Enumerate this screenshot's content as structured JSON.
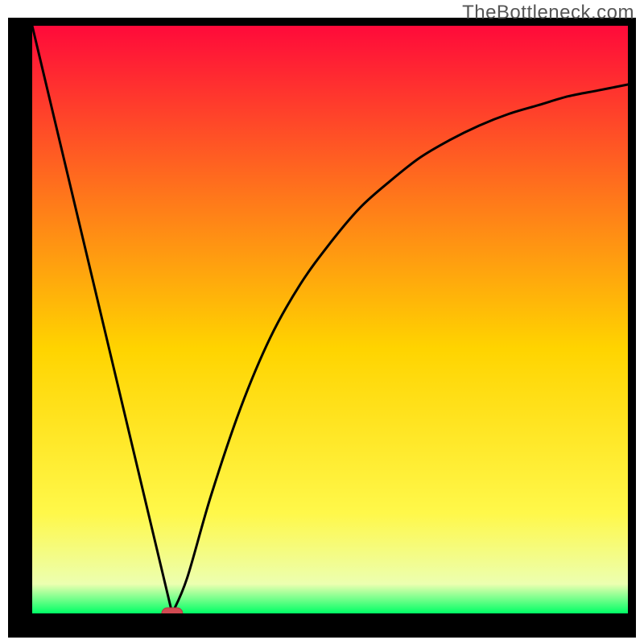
{
  "watermark": "TheBottleneck.com",
  "colors": {
    "frame": "#000000",
    "gradient_top": "#ff0a3a",
    "gradient_upper_mid": "#ff7a1a",
    "gradient_mid": "#ffd400",
    "gradient_lower_mid": "#fff84a",
    "gradient_low": "#ecffb0",
    "gradient_bottom": "#00ff66",
    "curve": "#000000",
    "marker_fill": "#d14a52",
    "marker_stroke": "#b23a42"
  },
  "chart_data": {
    "type": "line",
    "title": "",
    "xlabel": "",
    "ylabel": "",
    "x_range": [
      0,
      100
    ],
    "y_range": [
      0,
      100
    ],
    "series": [
      {
        "name": "bottleneck-curve",
        "points": [
          {
            "x": 0.0,
            "y": 100.0
          },
          {
            "x": 23.5,
            "y": 0.0
          },
          {
            "x": 26.0,
            "y": 6.0
          },
          {
            "x": 30.0,
            "y": 20.0
          },
          {
            "x": 35.0,
            "y": 35.0
          },
          {
            "x": 40.0,
            "y": 47.0
          },
          {
            "x": 45.0,
            "y": 56.0
          },
          {
            "x": 50.0,
            "y": 63.0
          },
          {
            "x": 55.0,
            "y": 69.0
          },
          {
            "x": 60.0,
            "y": 73.5
          },
          {
            "x": 65.0,
            "y": 77.5
          },
          {
            "x": 70.0,
            "y": 80.5
          },
          {
            "x": 75.0,
            "y": 83.0
          },
          {
            "x": 80.0,
            "y": 85.0
          },
          {
            "x": 85.0,
            "y": 86.5
          },
          {
            "x": 90.0,
            "y": 88.0
          },
          {
            "x": 95.0,
            "y": 89.0
          },
          {
            "x": 100.0,
            "y": 90.0
          }
        ]
      }
    ],
    "marker": {
      "x": 23.5,
      "y": 0.0,
      "shape": "rounded-rect"
    },
    "gradient_axis": "vertical",
    "gradient_meaning": "top=red=high bottleneck, bottom=green=low bottleneck"
  }
}
